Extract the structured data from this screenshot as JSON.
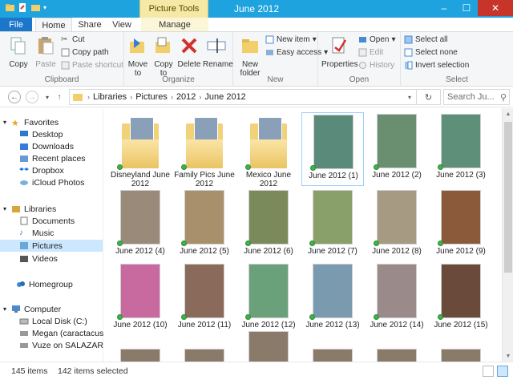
{
  "window": {
    "title": "June 2012",
    "context_tab": "Picture Tools",
    "minimize": "–",
    "maximize": "☐",
    "close": "✕"
  },
  "tabs": {
    "file": "File",
    "home": "Home",
    "share": "Share",
    "view": "View",
    "manage": "Manage"
  },
  "ribbon": {
    "clipboard": {
      "label": "Clipboard",
      "copy": "Copy",
      "paste": "Paste",
      "cut": "Cut",
      "copy_path": "Copy path",
      "paste_shortcut": "Paste shortcut"
    },
    "organize": {
      "label": "Organize",
      "move_to": "Move to",
      "copy_to": "Copy to",
      "delete": "Delete",
      "rename": "Rename"
    },
    "new": {
      "label": "New",
      "new_folder": "New folder",
      "new_item": "New item",
      "easy_access": "Easy access"
    },
    "open": {
      "label": "Open",
      "properties": "Properties",
      "open": "Open",
      "edit": "Edit",
      "history": "History"
    },
    "select": {
      "label": "Select",
      "select_all": "Select all",
      "select_none": "Select none",
      "invert": "Invert selection"
    }
  },
  "address": {
    "crumbs": [
      "Libraries",
      "Pictures",
      "2012",
      "June 2012"
    ],
    "search_placeholder": "Search Ju..."
  },
  "navpane": {
    "favorites": "Favorites",
    "desktop": "Desktop",
    "downloads": "Downloads",
    "recent": "Recent places",
    "dropbox": "Dropbox",
    "icloud": "iCloud Photos",
    "libraries": "Libraries",
    "documents": "Documents",
    "music": "Music",
    "pictures": "Pictures",
    "videos": "Videos",
    "homegroup": "Homegroup",
    "computer": "Computer",
    "local_disk": "Local Disk (C:)",
    "megan": "Megan (caractacus",
    "vuze": "Vuze on SALAZAR"
  },
  "items": [
    {
      "name": "Disneyland June 2012",
      "kind": "folder"
    },
    {
      "name": "Family Pics June 2012",
      "kind": "folder"
    },
    {
      "name": "Mexico June 2012",
      "kind": "folder"
    },
    {
      "name": "June 2012 (1)",
      "kind": "photo",
      "color": "#5a8a7a"
    },
    {
      "name": "June 2012 (2)",
      "kind": "photo",
      "color": "#6a8f70"
    },
    {
      "name": "June 2012 (3)",
      "kind": "photo",
      "color": "#5e8f78"
    },
    {
      "name": "June 2012 (4)",
      "kind": "photo",
      "color": "#9a8a7a"
    },
    {
      "name": "June 2012 (5)",
      "kind": "photo",
      "color": "#a8906c"
    },
    {
      "name": "June 2012 (6)",
      "kind": "photo",
      "color": "#7a8a5a"
    },
    {
      "name": "June 2012 (7)",
      "kind": "photo",
      "color": "#8aa06a"
    },
    {
      "name": "June 2012 (8)",
      "kind": "photo",
      "color": "#a69a82"
    },
    {
      "name": "June 2012 (9)",
      "kind": "photo",
      "color": "#8a5a3a"
    },
    {
      "name": "June 2012 (10)",
      "kind": "photo",
      "color": "#c86aa0"
    },
    {
      "name": "June 2012 (11)",
      "kind": "photo",
      "color": "#8a6a5a"
    },
    {
      "name": "June 2012 (12)",
      "kind": "photo",
      "color": "#6aa07a"
    },
    {
      "name": "June 2012 (13)",
      "kind": "photo",
      "color": "#7a9ab0"
    },
    {
      "name": "June 2012 (14)",
      "kind": "photo",
      "color": "#9a8a8a"
    },
    {
      "name": "June 2012 (15)",
      "kind": "photo",
      "color": "#6a4a3a"
    }
  ],
  "status": {
    "count": "145 items",
    "selected": "142 items selected"
  }
}
